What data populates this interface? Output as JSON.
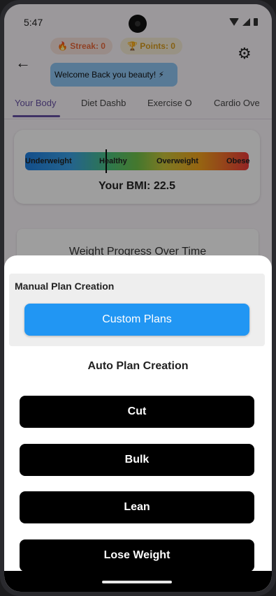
{
  "status_bar": {
    "time": "5:47"
  },
  "header": {
    "streak": "🔥 Streak: 0",
    "points": "🏆 Points: 0",
    "welcome": "Welcome Back you beauty! ⚡",
    "back_icon": "back-arrow-icon",
    "settings_icon": "gear-icon"
  },
  "tabs": [
    {
      "label": "Your Body",
      "active": true
    },
    {
      "label": "Diet Dashb",
      "active": false
    },
    {
      "label": "Exercise O",
      "active": false
    },
    {
      "label": "Cardio Ove",
      "active": false
    }
  ],
  "bmi": {
    "labels": [
      "Underweight",
      "Healthy",
      "Overweight",
      "Obese"
    ],
    "value_text": "Your BMI: 22.5",
    "value": 22.5
  },
  "progress": {
    "title": "Weight Progress Over Time"
  },
  "sheet": {
    "manual_title": "Manual Plan Creation",
    "custom_button": "Custom Plans",
    "auto_title": "Auto Plan Creation",
    "plans": [
      "Cut",
      "Bulk",
      "Lean",
      "Lose Weight"
    ]
  },
  "colors": {
    "accent": "#6750a4",
    "custom_button": "#2196f3",
    "plan_button": "#000000"
  }
}
